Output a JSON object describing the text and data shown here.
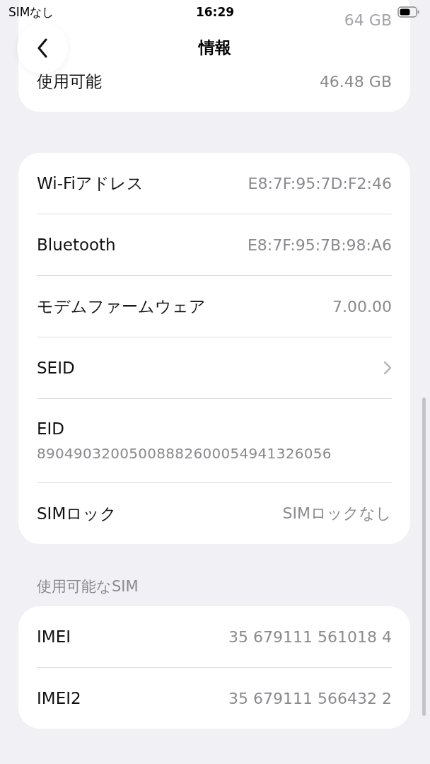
{
  "status_bar": {
    "carrier": "SIMなし",
    "time": "16:29"
  },
  "nav": {
    "title": "情報"
  },
  "storage_card": {
    "rows": [
      {
        "kind": "hidden",
        "value": "64 GB"
      },
      {
        "kind": "value",
        "label": "使用可能",
        "value": "46.48 GB"
      }
    ]
  },
  "network_card": {
    "rows": [
      {
        "kind": "value",
        "label": "Wi-Fiアドレス",
        "value": "E8:7F:95:7D:F2:46"
      },
      {
        "kind": "value",
        "label": "Bluetooth",
        "value": "E8:7F:95:7B:98:A6"
      },
      {
        "kind": "value",
        "label": "モデムファームウェア",
        "value": "7.00.00"
      },
      {
        "kind": "link",
        "label": "SEID"
      },
      {
        "kind": "stacked",
        "label": "EID",
        "value": "89049032005008882600054941326056"
      },
      {
        "kind": "value",
        "label": "SIMロック",
        "value": "SIMロックなし"
      }
    ]
  },
  "sim_section": {
    "header": "使用可能なSIM",
    "rows": [
      {
        "kind": "value",
        "label": "IMEI",
        "value": "35 679111 561018 4"
      },
      {
        "kind": "value",
        "label": "IMEI2",
        "value": "35 679111 566432 2"
      }
    ]
  }
}
